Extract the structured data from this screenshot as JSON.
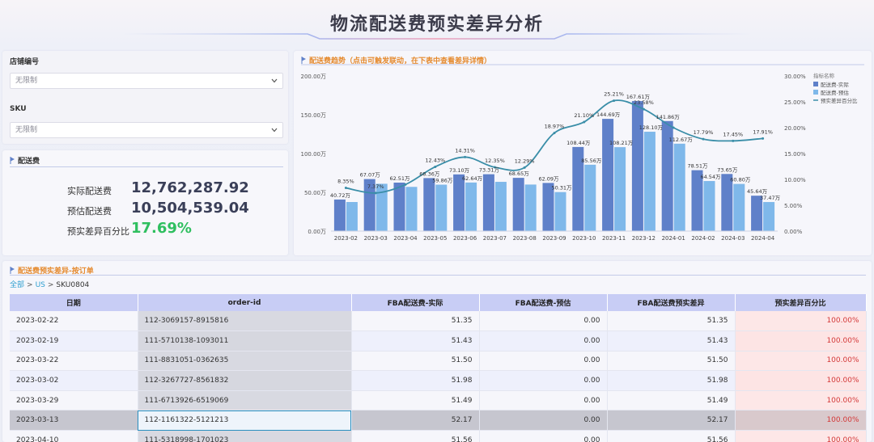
{
  "header": {
    "title": "物流配送费预实差异分析"
  },
  "filters": {
    "store": {
      "label": "店铺编号",
      "value": "无限制"
    },
    "sku": {
      "label": "SKU",
      "value": "无限制"
    }
  },
  "kpi": {
    "title": "配送费",
    "rows": [
      {
        "label": "实际配送费",
        "value": "12,762,287.92"
      },
      {
        "label": "预估配送费",
        "value": "10,504,539.04"
      },
      {
        "label": "预实差异百分比",
        "value": "17.69%"
      }
    ]
  },
  "chart": {
    "title": "配送费趋势（点击可触发联动，在下表中查看差异详情）",
    "legend_title": "指标名称",
    "left_ticks": [
      "200.00万",
      "150.00万",
      "100.00万",
      "50.00万",
      "0.00万"
    ],
    "right_ticks": [
      "30.00%",
      "25.00%",
      "20.00%",
      "15.00%",
      "10.00%",
      "5.00%",
      "0.00%"
    ]
  },
  "chart_data": {
    "type": "bar",
    "categories": [
      "2023-02",
      "2023-03",
      "2023-04",
      "2023-05",
      "2023-06",
      "2023-07",
      "2023-08",
      "2023-09",
      "2023-10",
      "2023-11",
      "2023-12",
      "2024-01",
      "2024-02",
      "2024-03",
      "2024-04"
    ],
    "series": [
      {
        "name": "配送费-实际",
        "type": "bar",
        "axis": "left",
        "values": [
          40.72,
          67.07,
          62.51,
          68.36,
          73.1,
          73.31,
          68.65,
          62.09,
          108.44,
          144.69,
          167.61,
          141.86,
          78.51,
          73.65,
          45.64
        ],
        "labels": [
          "40.72万",
          "67.07万",
          "62.51万",
          "68.36万",
          "73.10万",
          "73.31万",
          "68.65万",
          "62.09万",
          "108.44万",
          "144.69万",
          "167.61万",
          "141.86万",
          "78.51万",
          "73.65万",
          "45.64万"
        ]
      },
      {
        "name": "配送费-预估",
        "type": "bar",
        "axis": "left",
        "values": [
          37.5,
          61.0,
          57.0,
          59.86,
          62.64,
          63.5,
          60.0,
          50.31,
          85.56,
          108.21,
          128.1,
          112.67,
          64.54,
          60.8,
          37.47
        ],
        "labels": [
          "",
          "",
          "",
          "59.86万",
          "62.64万",
          "",
          "",
          "50.31万",
          "85.56万",
          "108.21万",
          "128.10万",
          "112.67万",
          "64.54万",
          "60.80万",
          "37.47万"
        ]
      },
      {
        "name": "预实差异百分比",
        "type": "line",
        "axis": "right",
        "values": [
          8.35,
          7.37,
          9.0,
          12.43,
          14.31,
          12.35,
          12.29,
          18.97,
          21.1,
          25.21,
          23.58,
          20.0,
          17.79,
          17.45,
          17.91
        ],
        "labels": [
          "8.35%",
          "7.37%",
          "",
          "12.43%",
          "14.31%",
          "12.35%",
          "12.29%",
          "18.97%",
          "21.10%",
          "25.21%",
          "23.58%",
          "",
          "17.79%",
          "17.45%",
          "17.91%"
        ]
      }
    ],
    "ylim_left": [
      0,
      200
    ],
    "ylim_right": [
      0,
      30
    ],
    "colors": {
      "actual": "#5f80c9",
      "estimate": "#7fb8ea",
      "line": "#3a8ea8"
    },
    "legend_position": "top-right"
  },
  "table": {
    "title": "配送费预实差异-按订单",
    "breadcrumb": {
      "all": "全部",
      "country": "US",
      "sku": "SKU0804",
      "sep": ">"
    },
    "columns": [
      "日期",
      "order-id",
      "FBA配送费-实际",
      "FBA配送费-预估",
      "FBA配送费预实差异",
      "预实差异百分比"
    ],
    "rows": [
      [
        "2023-02-22",
        "112-3069157-8915816",
        "51.35",
        "0.00",
        "51.35",
        "100.00%"
      ],
      [
        "2023-02-19",
        "111-5710138-1093011",
        "51.43",
        "0.00",
        "51.43",
        "100.00%"
      ],
      [
        "2023-03-22",
        "111-8831051-0362635",
        "51.50",
        "0.00",
        "51.50",
        "100.00%"
      ],
      [
        "2023-03-02",
        "112-3267727-8561832",
        "51.98",
        "0.00",
        "51.98",
        "100.00%"
      ],
      [
        "2023-03-29",
        "111-6713926-6519069",
        "51.49",
        "0.00",
        "51.49",
        "100.00%"
      ],
      [
        "2023-03-13",
        "112-1161322-5121213",
        "52.17",
        "0.00",
        "52.17",
        "100.00%"
      ],
      [
        "2023-04-10",
        "111-5318998-1701023",
        "51.56",
        "0.00",
        "51.56",
        "100.00%"
      ]
    ],
    "selected_row": 5
  }
}
